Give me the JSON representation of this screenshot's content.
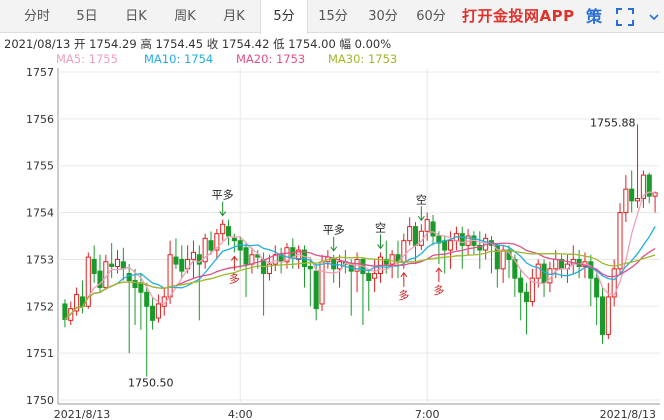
{
  "tabs": [
    {
      "label": "分时",
      "active": false
    },
    {
      "label": "5日",
      "active": false
    },
    {
      "label": "日K",
      "active": false
    },
    {
      "label": "周K",
      "active": false
    },
    {
      "label": "月K",
      "active": false
    },
    {
      "label": "5分",
      "active": true
    },
    {
      "label": "15分",
      "active": false
    },
    {
      "label": "30分",
      "active": false
    },
    {
      "label": "60分",
      "active": false
    }
  ],
  "brand": "打开金投网APP",
  "icons": {
    "strategy_label": "策",
    "fullscreen": "fullscreen-icon"
  },
  "info": {
    "date": "2021/08/13",
    "open_label": "开",
    "open": "1754.29",
    "high_label": "高",
    "high": "1754.45",
    "close_label": "收",
    "close": "1754.42",
    "low_label": "低",
    "low": "1754.00",
    "amp_label": "幅",
    "amp": "0.00%"
  },
  "ma": [
    {
      "label": "MA5: 1755",
      "color": "#f0a0b8"
    },
    {
      "label": "MA10: 1754",
      "color": "#22aee0"
    },
    {
      "label": "MA20: 1753",
      "color": "#e0508a"
    },
    {
      "label": "MA30: 1753",
      "color": "#9eb82a"
    }
  ],
  "colors": {
    "up": "#e02020",
    "down": "#1a9a2a",
    "grid": "#e8e8e8"
  },
  "chart_data": {
    "type": "candlestick",
    "ylim": [
      1750,
      1757
    ],
    "yticks": [
      1757,
      1756,
      1755,
      1754,
      1753,
      1752,
      1751,
      1750
    ],
    "xticks": [
      "2021/8/13",
      "4:00",
      "7:00",
      "2021/8/13"
    ],
    "annotations": [
      {
        "text": "1755.88",
        "kind": "high"
      },
      {
        "text": "1750.50",
        "kind": "low"
      }
    ],
    "signals": [
      {
        "text": "平多",
        "dir": "down"
      },
      {
        "text": "多",
        "dir": "up"
      },
      {
        "text": "平多",
        "dir": "down"
      },
      {
        "text": "空",
        "dir": "down"
      },
      {
        "text": "多",
        "dir": "up"
      },
      {
        "text": "空",
        "dir": "down"
      },
      {
        "text": "多",
        "dir": "up"
      }
    ],
    "candles": [
      [
        1752.05,
        1751.72,
        1752.15,
        1751.55
      ],
      [
        1751.7,
        1751.95,
        1752.1,
        1751.6
      ],
      [
        1751.9,
        1752.25,
        1752.4,
        1751.8
      ],
      [
        1752.2,
        1752.0,
        1752.55,
        1751.85
      ],
      [
        1752.0,
        1753.05,
        1753.15,
        1751.95
      ],
      [
        1753.0,
        1752.7,
        1753.3,
        1752.5
      ],
      [
        1752.75,
        1752.4,
        1753.1,
        1752.3
      ],
      [
        1752.4,
        1752.95,
        1753.1,
        1752.35
      ],
      [
        1752.9,
        1752.85,
        1753.35,
        1752.6
      ],
      [
        1752.85,
        1753.0,
        1753.2,
        1752.7
      ],
      [
        1752.95,
        1752.8,
        1753.25,
        1752.55
      ],
      [
        1752.7,
        1752.55,
        1752.9,
        1751.0
      ],
      [
        1752.55,
        1752.4,
        1752.8,
        1751.6
      ],
      [
        1752.5,
        1752.3,
        1752.7,
        1751.5
      ],
      [
        1752.3,
        1752.0,
        1752.5,
        1750.5
      ],
      [
        1752.0,
        1751.7,
        1752.2,
        1751.5
      ],
      [
        1751.75,
        1752.05,
        1752.25,
        1751.65
      ],
      [
        1752.0,
        1752.2,
        1752.4,
        1751.8
      ],
      [
        1752.2,
        1753.1,
        1753.4,
        1752.05
      ],
      [
        1753.05,
        1752.9,
        1753.45,
        1752.8
      ],
      [
        1753.0,
        1752.75,
        1753.3,
        1752.6
      ],
      [
        1752.8,
        1753.0,
        1753.3,
        1752.7
      ],
      [
        1753.0,
        1753.15,
        1753.4,
        1752.6
      ],
      [
        1753.1,
        1752.9,
        1753.3,
        1751.7
      ],
      [
        1752.95,
        1753.45,
        1753.55,
        1752.8
      ],
      [
        1753.4,
        1753.2,
        1753.6,
        1753.1
      ],
      [
        1753.2,
        1753.55,
        1753.65,
        1753.0
      ],
      [
        1753.55,
        1753.75,
        1753.85,
        1753.4
      ],
      [
        1753.7,
        1753.5,
        1753.85,
        1753.3
      ],
      [
        1753.45,
        1753.4,
        1753.55,
        1753.15
      ],
      [
        1753.4,
        1753.2,
        1753.5,
        1752.8
      ],
      [
        1753.25,
        1752.9,
        1753.35,
        1752.2
      ],
      [
        1752.9,
        1753.1,
        1753.25,
        1752.7
      ],
      [
        1753.1,
        1753.05,
        1753.2,
        1752.8
      ],
      [
        1753.0,
        1752.7,
        1753.15,
        1751.8
      ],
      [
        1752.7,
        1752.9,
        1753.1,
        1752.55
      ],
      [
        1752.9,
        1753.1,
        1753.3,
        1752.75
      ],
      [
        1753.1,
        1752.95,
        1753.25,
        1752.7
      ],
      [
        1752.95,
        1753.25,
        1753.35,
        1752.8
      ],
      [
        1753.25,
        1753.05,
        1753.45,
        1752.8
      ],
      [
        1753.0,
        1753.2,
        1753.3,
        1752.8
      ],
      [
        1753.2,
        1752.85,
        1753.3,
        1752.4
      ],
      [
        1752.85,
        1752.8,
        1753.05,
        1752.0
      ],
      [
        1752.75,
        1751.95,
        1752.9,
        1751.7
      ],
      [
        1752.05,
        1752.95,
        1753.1,
        1751.9
      ],
      [
        1752.95,
        1753.05,
        1753.2,
        1752.8
      ],
      [
        1753.0,
        1752.8,
        1753.1,
        1752.5
      ],
      [
        1752.8,
        1752.95,
        1753.1,
        1752.4
      ],
      [
        1752.95,
        1752.9,
        1753.2,
        1752.7
      ],
      [
        1752.9,
        1752.75,
        1753.0,
        1751.8
      ],
      [
        1752.75,
        1753.0,
        1753.15,
        1752.3
      ],
      [
        1753.0,
        1752.7,
        1753.05,
        1751.6
      ],
      [
        1752.7,
        1752.55,
        1752.8,
        1751.9
      ],
      [
        1752.6,
        1752.7,
        1753.0,
        1752.3
      ],
      [
        1752.7,
        1753.05,
        1753.15,
        1752.5
      ],
      [
        1753.0,
        1752.9,
        1753.4,
        1752.7
      ],
      [
        1752.9,
        1753.1,
        1753.2,
        1752.6
      ],
      [
        1753.1,
        1752.95,
        1753.4,
        1752.6
      ],
      [
        1752.95,
        1753.4,
        1753.55,
        1752.8
      ],
      [
        1753.4,
        1753.7,
        1753.9,
        1753.3
      ],
      [
        1753.7,
        1753.3,
        1753.8,
        1752.9
      ],
      [
        1753.3,
        1753.6,
        1753.75,
        1753.2
      ],
      [
        1753.6,
        1753.85,
        1754.0,
        1753.4
      ],
      [
        1753.8,
        1753.5,
        1753.95,
        1753.3
      ],
      [
        1753.5,
        1753.35,
        1753.6,
        1752.9
      ],
      [
        1753.4,
        1753.2,
        1753.5,
        1752.7
      ],
      [
        1753.2,
        1753.4,
        1753.6,
        1752.8
      ],
      [
        1753.4,
        1753.55,
        1753.7,
        1753.2
      ],
      [
        1753.55,
        1753.3,
        1753.7,
        1752.8
      ],
      [
        1753.3,
        1753.5,
        1753.65,
        1753.1
      ],
      [
        1753.5,
        1753.3,
        1753.6,
        1753.1
      ],
      [
        1753.3,
        1753.2,
        1753.6,
        1752.8
      ],
      [
        1753.2,
        1753.45,
        1753.55,
        1753.0
      ],
      [
        1753.4,
        1753.3,
        1753.5,
        1752.7
      ],
      [
        1753.3,
        1752.8,
        1753.35,
        1752.4
      ],
      [
        1752.8,
        1753.2,
        1753.3,
        1752.5
      ],
      [
        1753.2,
        1753.0,
        1753.3,
        1752.6
      ],
      [
        1753.0,
        1752.6,
        1753.1,
        1752.2
      ],
      [
        1752.6,
        1752.3,
        1752.8,
        1751.7
      ],
      [
        1752.3,
        1752.1,
        1752.5,
        1751.4
      ],
      [
        1752.1,
        1752.6,
        1752.8,
        1752.0
      ],
      [
        1752.6,
        1752.9,
        1753.0,
        1752.4
      ],
      [
        1752.9,
        1752.5,
        1753.0,
        1752.2
      ],
      [
        1752.5,
        1752.8,
        1752.95,
        1752.3
      ],
      [
        1752.8,
        1753.0,
        1753.2,
        1752.6
      ],
      [
        1753.0,
        1752.8,
        1753.1,
        1752.6
      ],
      [
        1752.8,
        1752.9,
        1753.1,
        1752.5
      ],
      [
        1752.9,
        1753.0,
        1753.3,
        1752.7
      ],
      [
        1753.0,
        1752.85,
        1753.2,
        1752.6
      ],
      [
        1752.85,
        1752.95,
        1753.15,
        1752.6
      ],
      [
        1752.95,
        1752.6,
        1753.1,
        1752.0
      ],
      [
        1752.6,
        1752.2,
        1752.7,
        1751.6
      ],
      [
        1752.2,
        1751.4,
        1752.4,
        1751.2
      ],
      [
        1751.4,
        1752.2,
        1752.5,
        1751.3
      ],
      [
        1752.2,
        1752.8,
        1753.0,
        1752.0
      ],
      [
        1752.8,
        1754.0,
        1754.2,
        1752.7
      ],
      [
        1754.0,
        1754.5,
        1754.8,
        1753.8
      ],
      [
        1754.5,
        1754.25,
        1754.9,
        1754.0
      ],
      [
        1754.25,
        1754.3,
        1755.88,
        1754.1
      ],
      [
        1754.3,
        1754.8,
        1754.9,
        1754.1
      ],
      [
        1754.8,
        1754.35,
        1754.85,
        1754.2
      ],
      [
        1754.35,
        1754.42,
        1754.45,
        1754.0
      ]
    ],
    "ma_series": [
      {
        "name": "MA5"
      },
      {
        "name": "MA10"
      },
      {
        "name": "MA20"
      },
      {
        "name": "MA30"
      }
    ]
  }
}
